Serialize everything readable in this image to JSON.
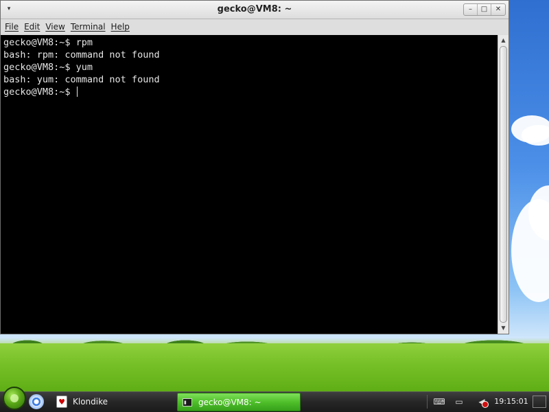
{
  "window": {
    "title": "gecko@VM8: ~",
    "controls": [
      "minimize",
      "maximize",
      "close"
    ]
  },
  "menubar": {
    "items": [
      {
        "label": "File"
      },
      {
        "label": "Edit"
      },
      {
        "label": "View"
      },
      {
        "label": "Terminal"
      },
      {
        "label": "Help"
      }
    ]
  },
  "terminal": {
    "lines": [
      "gecko@VM8:~$ rpm",
      "bash: rpm: command not found",
      "gecko@VM8:~$ yum",
      "bash: yum: command not found",
      "gecko@VM8:~$ "
    ],
    "colors": {
      "background": "#000000",
      "foreground": "#e6e6e6"
    }
  },
  "taskbar": {
    "tasks": [
      {
        "label": "Klondike",
        "icon": "cards-icon",
        "active": false
      },
      {
        "label": "gecko@VM8: ~",
        "icon": "terminal-icon",
        "active": true
      }
    ],
    "clock": "19:15:01",
    "accent_color": "#4fbf2a"
  }
}
